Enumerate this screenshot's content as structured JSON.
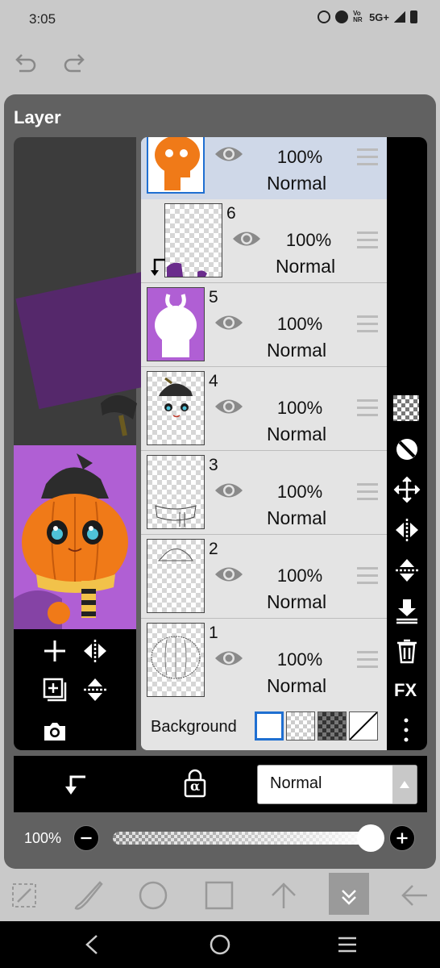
{
  "status": {
    "time": "3:05",
    "network": "5G+",
    "volte": "Vo NR"
  },
  "panel": {
    "title": "Layer"
  },
  "layers": [
    {
      "number": "",
      "opacity": "100%",
      "mode": "Normal",
      "selected": true
    },
    {
      "number": "6",
      "opacity": "100%",
      "mode": "Normal",
      "clipping": true
    },
    {
      "number": "5",
      "opacity": "100%",
      "mode": "Normal"
    },
    {
      "number": "4",
      "opacity": "100%",
      "mode": "Normal"
    },
    {
      "number": "3",
      "opacity": "100%",
      "mode": "Normal"
    },
    {
      "number": "2",
      "opacity": "100%",
      "mode": "Normal"
    },
    {
      "number": "1",
      "opacity": "100%",
      "mode": "Normal"
    }
  ],
  "background": {
    "label": "Background"
  },
  "right_tools": {
    "fx_label": "FX"
  },
  "blend": {
    "mode": "Normal",
    "alpha_lock_label": "α"
  },
  "opacity": {
    "label": "100%",
    "value": 1.0
  },
  "colors": {
    "panel": "#616161",
    "selected_layer": "#cfd8e8",
    "accent": "#1f6fd1",
    "purple": "#b05fd4"
  }
}
